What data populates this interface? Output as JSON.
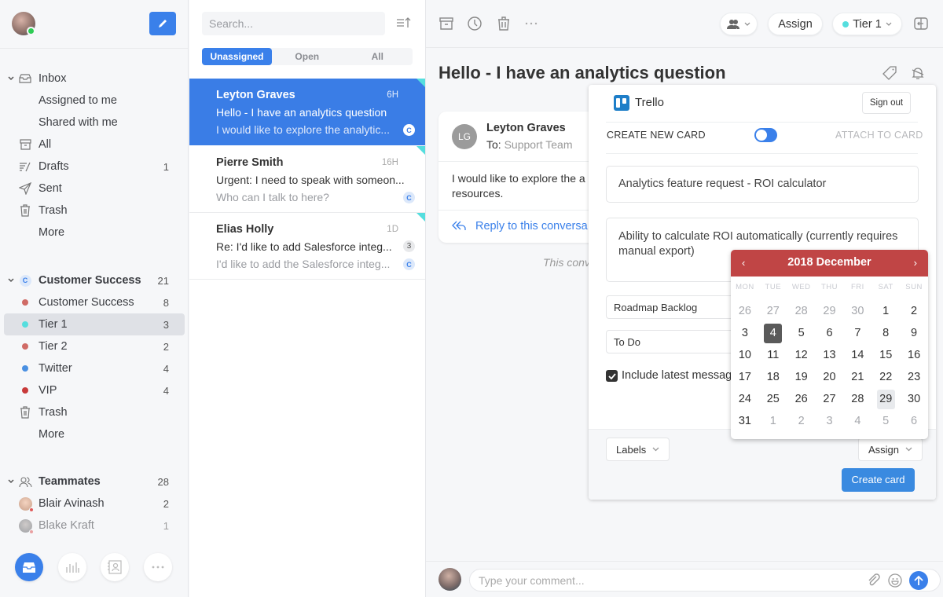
{
  "sidebar": {
    "inbox_section": {
      "label": "Inbox",
      "items": [
        {
          "label": "Assigned to me",
          "count": ""
        },
        {
          "label": "Shared with me",
          "count": ""
        },
        {
          "label": "All",
          "icon": "archive-icon",
          "count": ""
        },
        {
          "label": "Drafts",
          "icon": "drafts-icon",
          "count": "1"
        },
        {
          "label": "Sent",
          "icon": "send-icon",
          "count": ""
        },
        {
          "label": "Trash",
          "icon": "trash-icon",
          "count": ""
        },
        {
          "label": "More",
          "count": ""
        }
      ]
    },
    "team_section": {
      "label": "Customer Success",
      "badge": "C",
      "count": "21",
      "items": [
        {
          "label": "Customer Success",
          "count": "8",
          "color": "#d06b66"
        },
        {
          "label": "Tier 1",
          "count": "3",
          "color": "#55dede",
          "selected": true
        },
        {
          "label": "Tier 2",
          "count": "2",
          "color": "#d06b66"
        },
        {
          "label": "Twitter",
          "count": "4",
          "color": "#4a90e2"
        },
        {
          "label": "VIP",
          "count": "4",
          "color": "#c83a3a"
        },
        {
          "label": "Trash",
          "icon": "trash-icon",
          "count": ""
        },
        {
          "label": "More",
          "count": ""
        }
      ]
    },
    "teammates": {
      "label": "Teammates",
      "count": "28",
      "items": [
        {
          "label": "Blair Avinash",
          "count": "2"
        },
        {
          "label": "Blake Kraft",
          "count": "1"
        }
      ]
    },
    "bottom_nav": [
      "inbox-icon",
      "analytics-icon",
      "contacts-icon",
      "more-icon"
    ]
  },
  "list": {
    "search_placeholder": "Search...",
    "tabs": [
      "Unassigned",
      "Open",
      "All"
    ],
    "active_tab": "Unassigned",
    "conversations": [
      {
        "name": "Leyton Graves",
        "time": "6H",
        "subject": "Hello - I have an analytics question",
        "preview": "I would like to explore the analytic...",
        "badge": "C",
        "active": true
      },
      {
        "name": "Pierre Smith",
        "time": "16H",
        "subject": "Urgent: I need to speak with someon...",
        "preview": "Who can I talk to here?",
        "badge": "C"
      },
      {
        "name": "Elias Holly",
        "time": "1D",
        "subject": "Re: I'd like to add Salesforce integ...",
        "preview": "I'd like to add the Salesforce integ...",
        "badge": "C",
        "count": "3"
      }
    ]
  },
  "main": {
    "toolbar": {
      "assign_label": "Assign",
      "tag_label": "Tier 1",
      "tag_color": "#55dede"
    },
    "title": "Hello - I have an analytics question",
    "message": {
      "initials": "LG",
      "from": "Leyton Graves",
      "to_label": "To:",
      "to": "Support Team",
      "body_line1": "I would like to explore the a",
      "body_line2": "resources.",
      "reply_label": "Reply to this conversa"
    },
    "note": "This conv",
    "composer_placeholder": "Type your comment..."
  },
  "trello": {
    "name": "Trello",
    "sign_out": "Sign out",
    "create_new_card": "CREATE NEW CARD",
    "attach_to_card": "ATTACH TO CARD",
    "toggle_on": false,
    "card_title": "Analytics feature request - ROI calculator",
    "card_description": "Ability to calculate ROI automatically (currently requires manual export)",
    "board": "Roadmap Backlog",
    "list": "To Do",
    "include_latest": "Include latest messag",
    "include_checked": true,
    "labels_button": "Labels",
    "assign_button": "Assign",
    "create_button": "Create card"
  },
  "calendar": {
    "title": "2018 December",
    "prev": "‹",
    "next": "›",
    "weekdays": [
      "MON",
      "TUE",
      "WED",
      "THU",
      "FRI",
      "SAT",
      "SUN"
    ],
    "weeks": [
      [
        {
          "d": "26",
          "m": true
        },
        {
          "d": "27",
          "m": true
        },
        {
          "d": "28",
          "m": true
        },
        {
          "d": "29",
          "m": true
        },
        {
          "d": "30",
          "m": true
        },
        {
          "d": "1"
        },
        {
          "d": "2"
        }
      ],
      [
        {
          "d": "3"
        },
        {
          "d": "4",
          "sel": true
        },
        {
          "d": "5"
        },
        {
          "d": "6"
        },
        {
          "d": "7"
        },
        {
          "d": "8"
        },
        {
          "d": "9"
        }
      ],
      [
        {
          "d": "10"
        },
        {
          "d": "11"
        },
        {
          "d": "12"
        },
        {
          "d": "13"
        },
        {
          "d": "14"
        },
        {
          "d": "15"
        },
        {
          "d": "16"
        }
      ],
      [
        {
          "d": "17"
        },
        {
          "d": "18"
        },
        {
          "d": "19"
        },
        {
          "d": "20"
        },
        {
          "d": "21"
        },
        {
          "d": "22"
        },
        {
          "d": "23"
        }
      ],
      [
        {
          "d": "24"
        },
        {
          "d": "25"
        },
        {
          "d": "26"
        },
        {
          "d": "27"
        },
        {
          "d": "28"
        },
        {
          "d": "29",
          "today": true
        },
        {
          "d": "30"
        }
      ],
      [
        {
          "d": "31"
        },
        {
          "d": "1",
          "m": true
        },
        {
          "d": "2",
          "m": true
        },
        {
          "d": "3",
          "m": true
        },
        {
          "d": "4",
          "m": true
        },
        {
          "d": "5",
          "m": true
        },
        {
          "d": "6",
          "m": true
        }
      ]
    ]
  }
}
